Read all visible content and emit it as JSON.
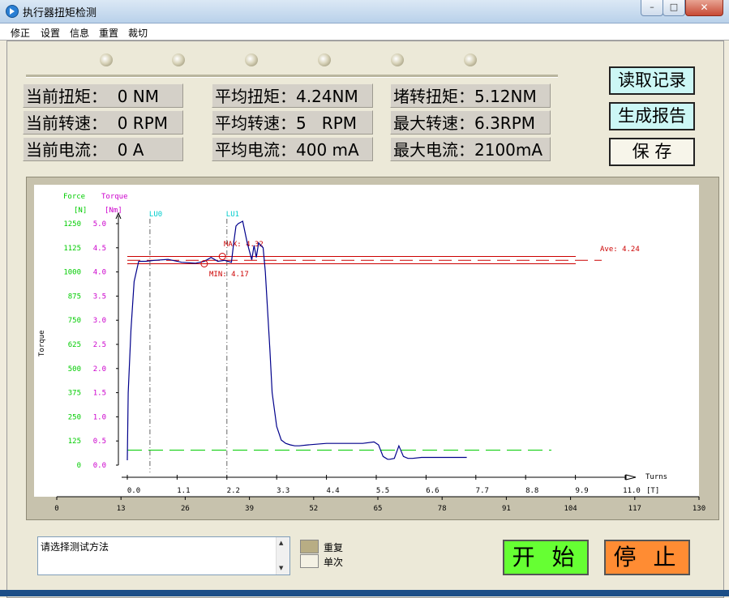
{
  "window": {
    "title": "执行器扭矩检测",
    "minimize": "–",
    "maximize": "□",
    "close": "✕"
  },
  "menu": [
    "修正",
    "设置",
    "信息",
    "重置",
    "裁切"
  ],
  "readings": {
    "current_torque": "当前扭矩：  0 NM",
    "current_speed": "当前转速：  0 RPM",
    "current_current": "当前电流：  0 A",
    "avg_torque": "平均扭矩：4.24NM",
    "avg_speed": "平均转速：5   RPM",
    "avg_current": "平均电流：400 mA",
    "stall_torque": "堵转扭矩：5.12NM",
    "max_speed": "最大转速：6.3RPM",
    "max_current": "最大电流：2100mA"
  },
  "buttons": {
    "read_record": "读取记录",
    "gen_report": "生成报告",
    "save": "保  存",
    "start": "开 始",
    "stop": "停 止"
  },
  "mode": {
    "text": "请选择测试方法",
    "repeat": "重复",
    "single": "单次"
  },
  "colors": {
    "accent_green": "#66ff33",
    "accent_orange": "#ff8c33",
    "curve": "#00008b",
    "limit": "#cc0000",
    "green_axis": "#00cc00",
    "magenta_axis": "#cc00cc",
    "marker": "#00cccc"
  },
  "chart_data": {
    "type": "line",
    "ylabel": "Torque",
    "left_axis_label": "Force",
    "left_axis_unit": "[N]",
    "right_axis_label": "Torque",
    "right_axis_unit": "[Nm]",
    "x_label": "Turns",
    "x_unit": "[T]",
    "force_ticks": [
      "0",
      "125",
      "250",
      "375",
      "500",
      "625",
      "750",
      "875",
      "1000",
      "1125",
      "1250"
    ],
    "torque_ticks": [
      "0.0",
      "0.5",
      "1.0",
      "1.5",
      "2.0",
      "2.5",
      "3.0",
      "3.5",
      "4.0",
      "4.5",
      "5.0"
    ],
    "turns_ticks": [
      "0.0",
      "1.1",
      "2.2",
      "3.3",
      "4.4",
      "5.5",
      "6.6",
      "7.7",
      "8.8",
      "9.9",
      "11.0"
    ],
    "bottom_ticks": [
      "0",
      "13",
      "26",
      "39",
      "52",
      "65",
      "78",
      "91",
      "104",
      "117",
      "130"
    ],
    "xlim": [
      0,
      11
    ],
    "ylim": [
      0,
      5
    ],
    "max_label": "MAX: 4.32",
    "min_label": "MIN: 4.17",
    "ave_label": "Ave: 4.24",
    "max": 4.32,
    "min": 4.17,
    "avg": 4.24,
    "threshold": 0.31,
    "markers": [
      {
        "label": "LU0",
        "x": 0.5
      },
      {
        "label": "LU1",
        "x": 2.2
      }
    ],
    "series": [
      {
        "x": [
          0.0,
          0.02,
          0.08,
          0.15,
          0.25,
          0.4,
          0.6,
          0.9,
          1.2,
          1.5,
          1.7,
          1.85,
          2.0,
          2.15,
          2.3,
          2.35,
          2.4,
          2.45,
          2.55,
          2.65,
          2.75,
          2.8,
          2.85,
          2.9,
          3.0,
          3.05,
          3.1,
          3.15,
          3.2,
          3.3,
          3.4,
          3.5,
          3.6,
          3.7,
          3.8,
          4.0,
          4.4,
          4.8,
          5.2,
          5.45,
          5.55,
          5.65,
          5.75,
          5.8,
          5.9,
          6.0,
          6.1,
          6.2,
          6.3,
          6.5,
          7.0,
          7.5
        ],
        "y": [
          0.1,
          1.5,
          2.8,
          3.8,
          4.22,
          4.22,
          4.24,
          4.26,
          4.2,
          4.18,
          4.22,
          4.3,
          4.22,
          4.24,
          4.2,
          4.6,
          4.95,
          5.0,
          5.05,
          4.6,
          4.25,
          4.55,
          4.3,
          4.6,
          4.5,
          4.0,
          3.2,
          2.4,
          1.5,
          0.8,
          0.52,
          0.45,
          0.42,
          0.4,
          0.4,
          0.42,
          0.45,
          0.45,
          0.45,
          0.48,
          0.42,
          0.18,
          0.12,
          0.12,
          0.14,
          0.4,
          0.18,
          0.14,
          0.14,
          0.16,
          0.16,
          0.16
        ]
      }
    ]
  }
}
